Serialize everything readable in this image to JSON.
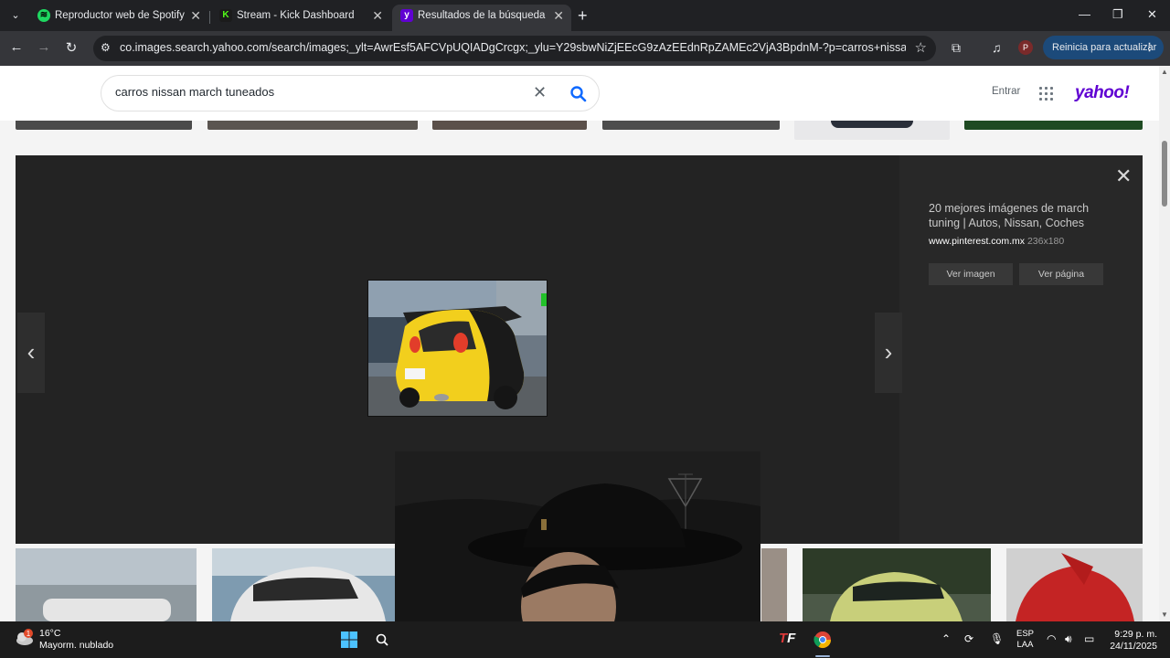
{
  "browser": {
    "tabs": [
      {
        "title": "Reproductor web de Spotify: m",
        "favicon": "spotify-icon",
        "color": "#1ed760"
      },
      {
        "title": "Stream - Kick Dashboard",
        "favicon": "kick-icon",
        "color": "#53fc18"
      },
      {
        "title": "Resultados de la búsqueda de",
        "favicon": "yahoo-icon",
        "color": "#6001d2",
        "active": true
      }
    ],
    "url": "co.images.search.yahoo.com/search/images;_ylt=AwrEsf5AFCVpUQIADgCrcgx;_ylu=Y29sbwNiZjEEcG9zAzEEdnRpZAMEc2VjA3BpdnM-?p=carros+nissan+march+tun...",
    "update_button": "Reinicia para actualizar",
    "profile_initial": "P"
  },
  "yahoo": {
    "search_query": "carros nissan march tuneados",
    "entrar": "Entrar",
    "logo": "yahoo!"
  },
  "lightbox": {
    "title": "20 mejores imágenes de march tuning | Autos, Nissan, Coches",
    "source_site": "www.pinterest.com.mx",
    "dimensions": "236x180",
    "view_image": "Ver imagen",
    "view_page": "Ver página"
  },
  "taskbar": {
    "temperature": "16°C",
    "weather": "Mayorm. nublado",
    "weather_badge": "1",
    "lang_line1": "ESP",
    "lang_line2": "LAA",
    "time": "9:29 p. m.",
    "date": "24/11/2025"
  }
}
